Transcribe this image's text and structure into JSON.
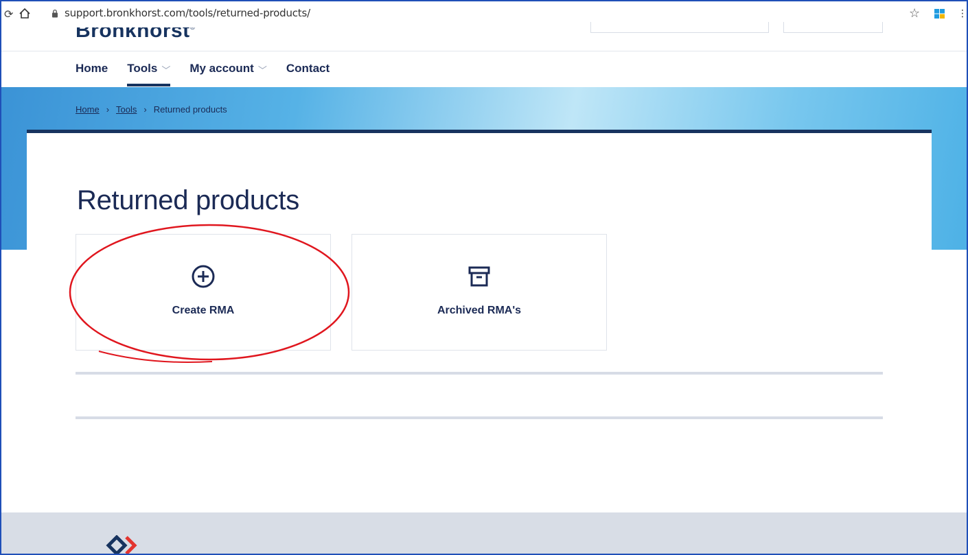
{
  "browser": {
    "url": "support.bronkhorst.com/tools/returned-products/",
    "star_icon": "star-icon",
    "extension_icon": "windows-icon"
  },
  "site": {
    "logo_text": "Bronkhorst",
    "logo_mark": "®"
  },
  "nav": {
    "items": [
      {
        "label": "Home",
        "has_dropdown": false
      },
      {
        "label": "Tools",
        "has_dropdown": true,
        "active": true
      },
      {
        "label": "My account",
        "has_dropdown": true
      },
      {
        "label": "Contact",
        "has_dropdown": false
      }
    ]
  },
  "breadcrumb": {
    "home": "Home",
    "tools": "Tools",
    "current": "Returned products",
    "separator": "›"
  },
  "page": {
    "title": "Returned products"
  },
  "tiles": [
    {
      "label": "Create RMA",
      "icon": "plus-circle-icon"
    },
    {
      "label": "Archived RMA's",
      "icon": "archive-box-icon"
    }
  ],
  "colors": {
    "brand_navy": "#17335f",
    "annotation_red": "#e0161e",
    "footer_bg": "#d8dde6",
    "logo_red": "#e3342f"
  }
}
